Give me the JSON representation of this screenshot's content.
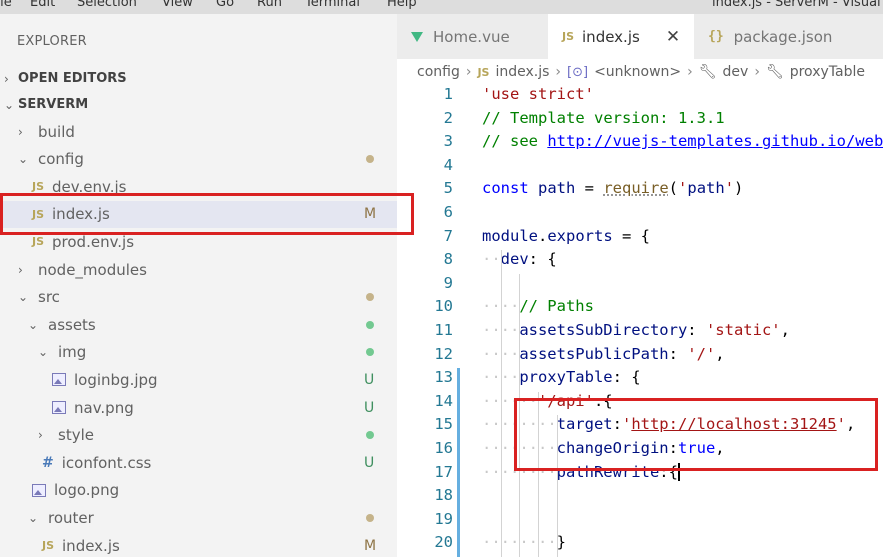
{
  "menubar": {
    "items": [
      "File",
      "Edit",
      "Selection",
      "View",
      "Go",
      "Run",
      "Terminal",
      "Help"
    ],
    "window_title": "index.js - ServerM - Visual Studio Code"
  },
  "sidebar": {
    "title": "EXPLORER",
    "sections": {
      "open_editors": "OPEN EDITORS",
      "project": "SERVERM"
    },
    "tree": [
      {
        "label": "build",
        "type": "folder",
        "expanded": false,
        "status": ""
      },
      {
        "label": "config",
        "type": "folder",
        "expanded": true,
        "status": "dot",
        "status_color": "#c5b38a"
      },
      {
        "label": "dev.env.js",
        "type": "js",
        "status": ""
      },
      {
        "label": "index.js",
        "type": "js",
        "status": "M",
        "status_color": "#8f7547",
        "selected": true
      },
      {
        "label": "prod.env.js",
        "type": "js",
        "status": ""
      },
      {
        "label": "node_modules",
        "type": "folder",
        "expanded": false,
        "status": ""
      },
      {
        "label": "src",
        "type": "folder",
        "expanded": true,
        "status": "dot",
        "status_color": "#c5b38a"
      },
      {
        "label": "assets",
        "type": "folder",
        "expanded": true,
        "status": "dot",
        "status_color": "#73c991"
      },
      {
        "label": "img",
        "type": "folder",
        "expanded": true,
        "status": "dot",
        "status_color": "#73c991"
      },
      {
        "label": "loginbg.jpg",
        "type": "image",
        "status": "U",
        "status_color": "#3f8f5f"
      },
      {
        "label": "nav.png",
        "type": "image",
        "status": "U",
        "status_color": "#3f8f5f"
      },
      {
        "label": "style",
        "type": "folder",
        "expanded": false,
        "status": "dot",
        "status_color": "#73c991"
      },
      {
        "label": "iconfont.css",
        "type": "css",
        "status": "U",
        "status_color": "#3f8f5f"
      },
      {
        "label": "logo.png",
        "type": "image",
        "status": ""
      },
      {
        "label": "router",
        "type": "folder",
        "expanded": true,
        "status": "dot",
        "status_color": "#c5b38a"
      },
      {
        "label": "index.js",
        "type": "js",
        "status": "M",
        "status_color": "#8f7547"
      }
    ]
  },
  "tabs": [
    {
      "label": "Home.vue",
      "icon": "vue-icon",
      "active": false
    },
    {
      "label": "index.js",
      "icon": "js-icon",
      "active": true
    },
    {
      "label": "package.json",
      "icon": "json-icon",
      "active": false
    }
  ],
  "breadcrumb": [
    "config",
    "index.js",
    "<unknown>",
    "dev",
    "proxyTable"
  ],
  "icons": {
    "js": "JS",
    "json": "{}",
    "css": "#",
    "close": "✕",
    "chevron_right": "›",
    "chevron_down": "⌄"
  },
  "code_lines": [
    {
      "n": "1",
      "text": "'use strict'"
    },
    {
      "n": "2",
      "text": "// Template version: 1.3.1"
    },
    {
      "n": "3",
      "text": "// see http://vuejs-templates.github.io/webpack for documentation."
    },
    {
      "n": "4",
      "text": ""
    },
    {
      "n": "5",
      "text": "const path = require('path')"
    },
    {
      "n": "6",
      "text": ""
    },
    {
      "n": "7",
      "text": "module.exports = {"
    },
    {
      "n": "8",
      "text": "  dev: {"
    },
    {
      "n": "9",
      "text": ""
    },
    {
      "n": "10",
      "text": "    // Paths"
    },
    {
      "n": "11",
      "text": "    assetsSubDirectory: 'static',"
    },
    {
      "n": "12",
      "text": "    assetsPublicPath: '/',"
    },
    {
      "n": "13",
      "text": "    proxyTable: {"
    },
    {
      "n": "14",
      "text": "      '/api':{"
    },
    {
      "n": "15",
      "text": "        target:'http://localhost:31245',"
    },
    {
      "n": "16",
      "text": "        changeOrigin:true,"
    },
    {
      "n": "17",
      "text": "        pathRewrite:{"
    },
    {
      "n": "18",
      "text": ""
    },
    {
      "n": "19",
      "text": ""
    },
    {
      "n": "20",
      "text": "        }"
    }
  ]
}
